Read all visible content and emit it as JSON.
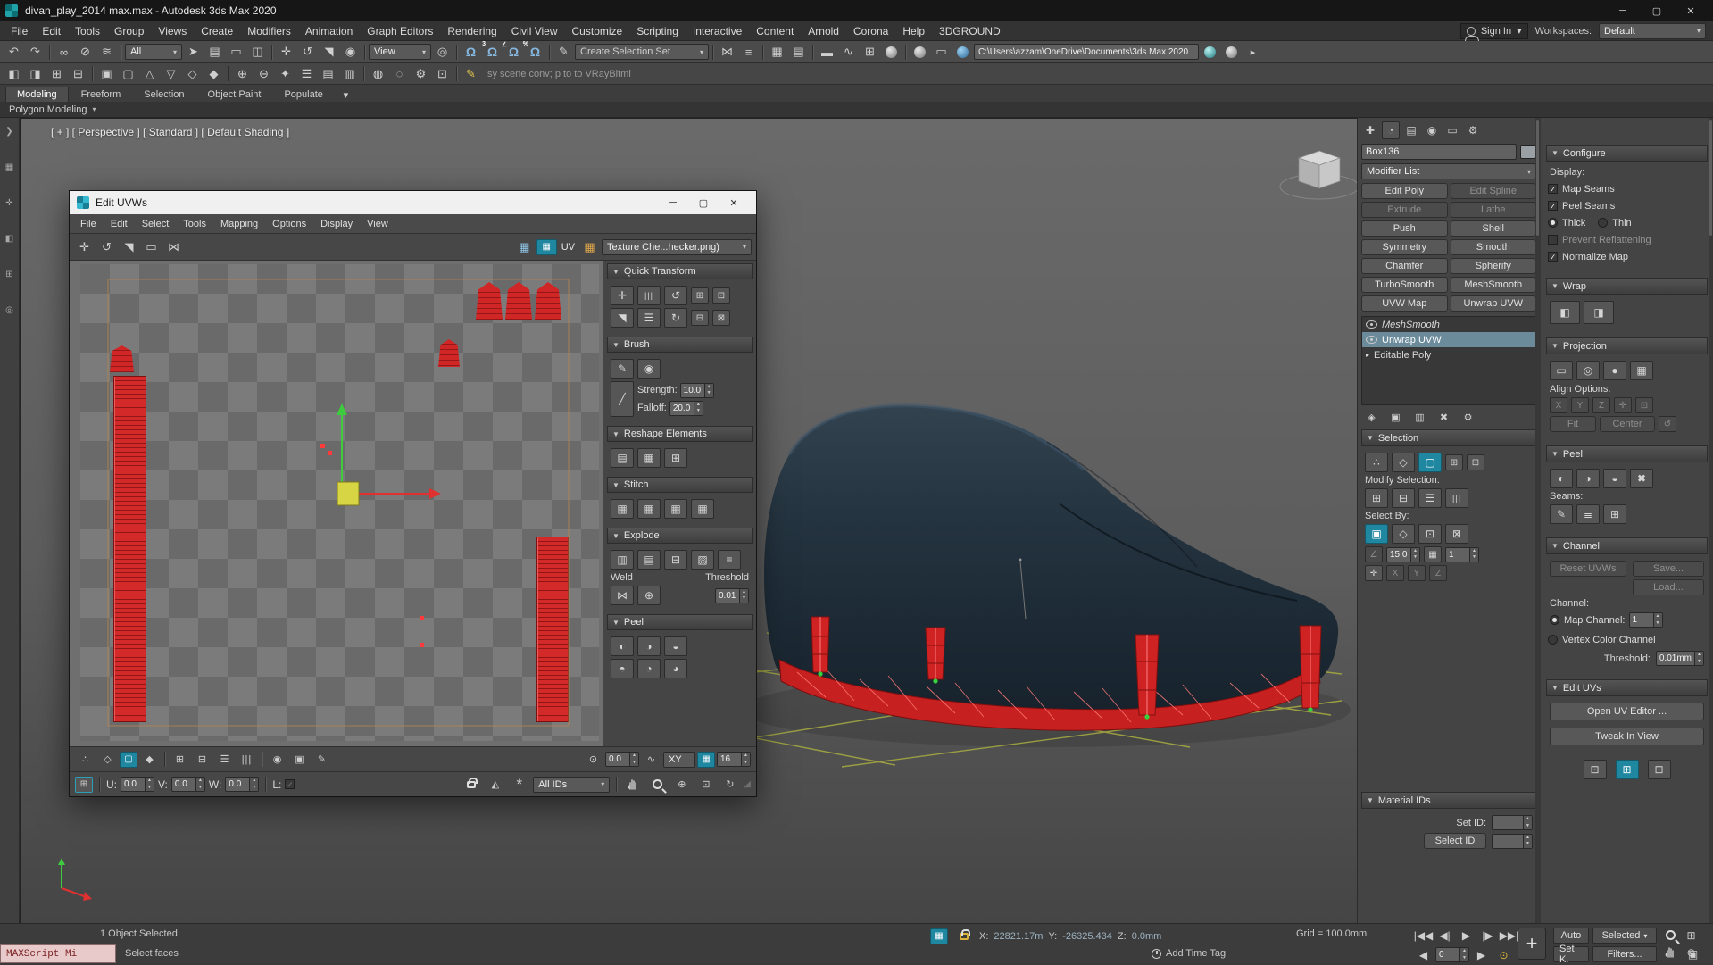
{
  "icons": {
    "minimize": "─",
    "maximize": "▢",
    "close": "✕"
  },
  "titlebar": {
    "title": "divan_play_2014 max.max - Autodesk 3ds Max 2020"
  },
  "menubar": {
    "items": [
      "File",
      "Edit",
      "Tools",
      "Group",
      "Views",
      "Create",
      "Modifiers",
      "Animation",
      "Graph Editors",
      "Rendering",
      "Civil View",
      "Customize",
      "Scripting",
      "Interactive",
      "Content",
      "Arnold",
      "Corona",
      "Help",
      "3DGROUND"
    ],
    "sign_in": "Sign In",
    "workspaces_label": "Workspaces:",
    "workspaces_value": "Default"
  },
  "toolbar": {
    "selection_filter": "All",
    "ref_coord": "View",
    "named_sets_placeholder": "Create Selection Set",
    "project_path": "C:\\Users\\azzam\\OneDrive\\Documents\\3ds Max 2020",
    "snap_badge": "3",
    "prompt_text": "sy scene conv; p to to VRayBitmi"
  },
  "ribbon": {
    "tabs": [
      "Modeling",
      "Freeform",
      "Selection",
      "Object Paint",
      "Populate"
    ],
    "subtab": "Polygon Modeling"
  },
  "viewport": {
    "label": "[ + ] [ Perspective ] [ Standard ] [ Default Shading ]"
  },
  "uvw_dialog": {
    "title": "Edit UVWs",
    "menu": [
      "File",
      "Edit",
      "Select",
      "Tools",
      "Mapping",
      "Options",
      "Display",
      "View"
    ],
    "uv_label": "UV",
    "texture_dropdown": "Texture Che...hecker.png)",
    "quick_transform_title": "Quick Transform",
    "brush_title": "Brush",
    "strength_label": "Strength:",
    "strength_value": "10.0",
    "falloff_label": "Falloff:",
    "falloff_value": "20.0",
    "reshape_title": "Reshape Elements",
    "stitch_title": "Stitch",
    "explode_title": "Explode",
    "weld_label": "Weld",
    "threshold_label": "Threshold",
    "threshold_value": "0.01",
    "peel_title": "Peel",
    "rotate_value": "0.0",
    "axis_value": "XY",
    "grid_value": "16",
    "u_label": "U:",
    "u_value": "0.0",
    "v_label": "V:",
    "v_value": "0.0",
    "w_label": "W:",
    "w_value": "0.0",
    "l_label": "L:",
    "ids_dropdown": "All IDs"
  },
  "command_panel": {
    "object_name": "Box136",
    "modifier_list": "Modifier List",
    "buttons": [
      "Edit Poly",
      "Edit Spline",
      "Extrude",
      "Lathe",
      "Push",
      "Shell",
      "Symmetry",
      "Smooth",
      "Chamfer",
      "Spherify",
      "TurboSmooth",
      "MeshSmooth",
      "UVW Map",
      "Unwrap UVW"
    ],
    "stack": [
      "MeshSmooth",
      "Unwrap UVW",
      "Editable Poly"
    ],
    "selection_title": "Selection",
    "modify_selection_label": "Modify Selection:",
    "select_by_label": "Select By:",
    "angle_value": "15.0",
    "id_value": "1",
    "axis_x": "X",
    "axis_y": "Y",
    "axis_z": "Z",
    "material_ids_title": "Material IDs",
    "set_id_label": "Set ID:",
    "select_id_label": "Select ID"
  },
  "unwrap_panel": {
    "configure_title": "Configure",
    "display_label": "Display:",
    "map_seams": "Map Seams",
    "peel_seams": "Peel Seams",
    "thick": "Thick",
    "thin": "Thin",
    "prevent_reflattening": "Prevent Reflattening",
    "normalize_map": "Normalize Map",
    "wrap_title": "Wrap",
    "projection_title": "Projection",
    "align_options_label": "Align Options:",
    "axis_x": "X",
    "axis_y": "Y",
    "axis_z": "Z",
    "fit": "Fit",
    "center": "Center",
    "peel_title": "Peel",
    "seams_label": "Seams:",
    "channel_title": "Channel",
    "reset_uvws": "Reset UVWs",
    "save": "Save...",
    "load": "Load...",
    "channel_label": "Channel:",
    "map_channel_label": "Map Channel:",
    "map_channel_value": "1",
    "vertex_color_channel": "Vertex Color Channel",
    "threshold_label": "Threshold:",
    "threshold_value": "0.01mm",
    "edit_uvs_title": "Edit UVs",
    "open_uv_editor": "Open UV Editor ...",
    "tweak_in_view": "Tweak In View"
  },
  "statusbar": {
    "selected_info": "1 Object Selected",
    "prompt": "Select faces",
    "maxscript_label": "MAXScript Mi",
    "x_label": "X:",
    "x_value": "22821.17m",
    "y_label": "Y:",
    "y_value": "-26325.434",
    "z_label": "Z:",
    "z_value": "0.0mm",
    "grid_label": "Grid = 100.0mm",
    "add_time_tag": "Add Time Tag",
    "auto": "Auto",
    "selected_mode": "Selected",
    "set_key": "Set K.",
    "filters": "Filters...",
    "frame_value": "0"
  }
}
